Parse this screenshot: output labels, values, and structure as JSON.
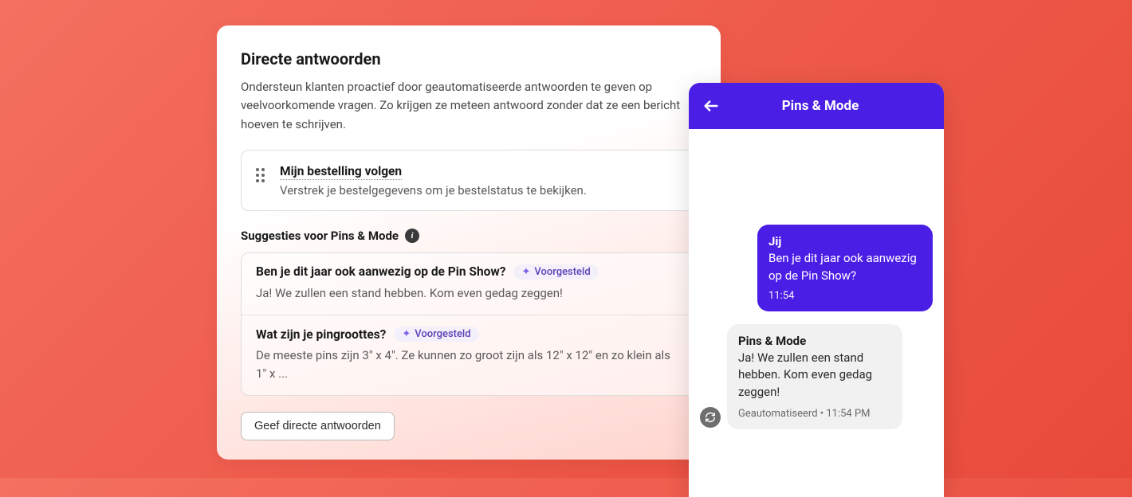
{
  "card": {
    "title": "Directe antwoorden",
    "desc": "Ondersteun klanten proactief door geautomatiseerde antwoorden te geven op veelvoorkomende vragen. Zo krijgen ze meteen antwoord zonder dat ze een bericht hoeven te schrijven.",
    "tracking": {
      "title": "Mijn bestelling volgen",
      "sub": "Verstrek je bestelgegevens om je bestelstatus te bekijken."
    },
    "subheading": "Suggesties voor Pins & Mode",
    "suggestions": [
      {
        "q": "Ben je dit jaar ook aanwezig op de Pin Show?",
        "badge": "Voorgesteld",
        "a": "Ja! We zullen een stand hebben. Kom even gedag zeggen!"
      },
      {
        "q": "Wat zijn je pingroottes?",
        "badge": "Voorgesteld",
        "a": "De meeste pins zijn 3\" x 4\". Ze kunnen zo groot zijn als 12\" x 12\" en zo klein als 1\" x ..."
      }
    ],
    "button": "Geef directe antwoorden"
  },
  "chat": {
    "store": "Pins & Mode",
    "out": {
      "sender": "Jij",
      "msg": "Ben je dit jaar ook aanwezig op de Pin Show?",
      "time": "11:54"
    },
    "in": {
      "sender": "Pins & Mode",
      "msg": "Ja! We zullen een stand hebben. Kom even gedag zeggen!",
      "meta": "Geautomatiseerd • 11:54 PM"
    }
  },
  "colors": {
    "accent": "#4b1ee6",
    "bg_gradient_from": "#f47060",
    "bg_gradient_to": "#e84a3a"
  }
}
